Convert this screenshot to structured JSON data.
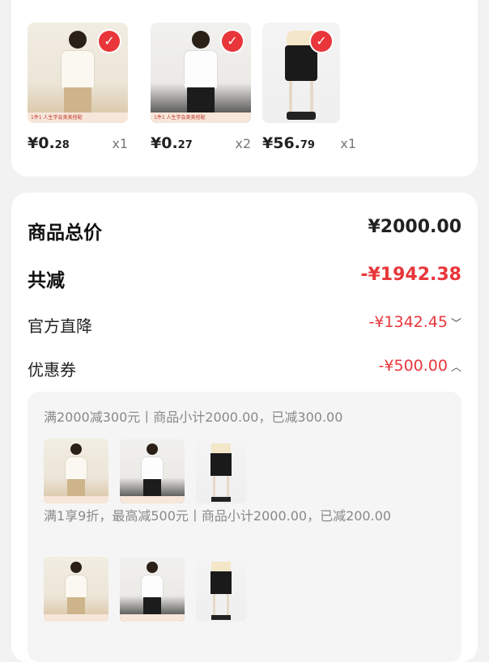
{
  "products": [
    {
      "price_main": "¥0.",
      "price_dec": "28",
      "qty": "x1",
      "promo": "1件1 人生学会美美搭配"
    },
    {
      "price_main": "¥0.",
      "price_dec": "27",
      "qty": "x2",
      "promo": "1件1 人生学会美美搭配"
    },
    {
      "price_main": "¥56.",
      "price_dec": "79",
      "qty": "x1",
      "promo": ""
    }
  ],
  "summary": {
    "total_label": "商品总价",
    "total_value": "¥2000.00",
    "discount_label": "共减",
    "discount_value": "-¥1942.38",
    "official_label": "官方直降",
    "official_value": "-¥1342.45",
    "coupon_label": "优惠券",
    "coupon_value": "-¥500.00"
  },
  "coupon_details": {
    "rule1": "满2000减300元丨商品小计2000.00，已减300.00",
    "rule2": "满1享9折，最高减500元丨商品小计2000.00，已减200.00"
  },
  "colors": {
    "accent": "#e8363a",
    "page_bg": "#f2f2f2"
  },
  "icons": [
    "check-icon",
    "chevron-down-icon",
    "chevron-up-icon"
  ]
}
